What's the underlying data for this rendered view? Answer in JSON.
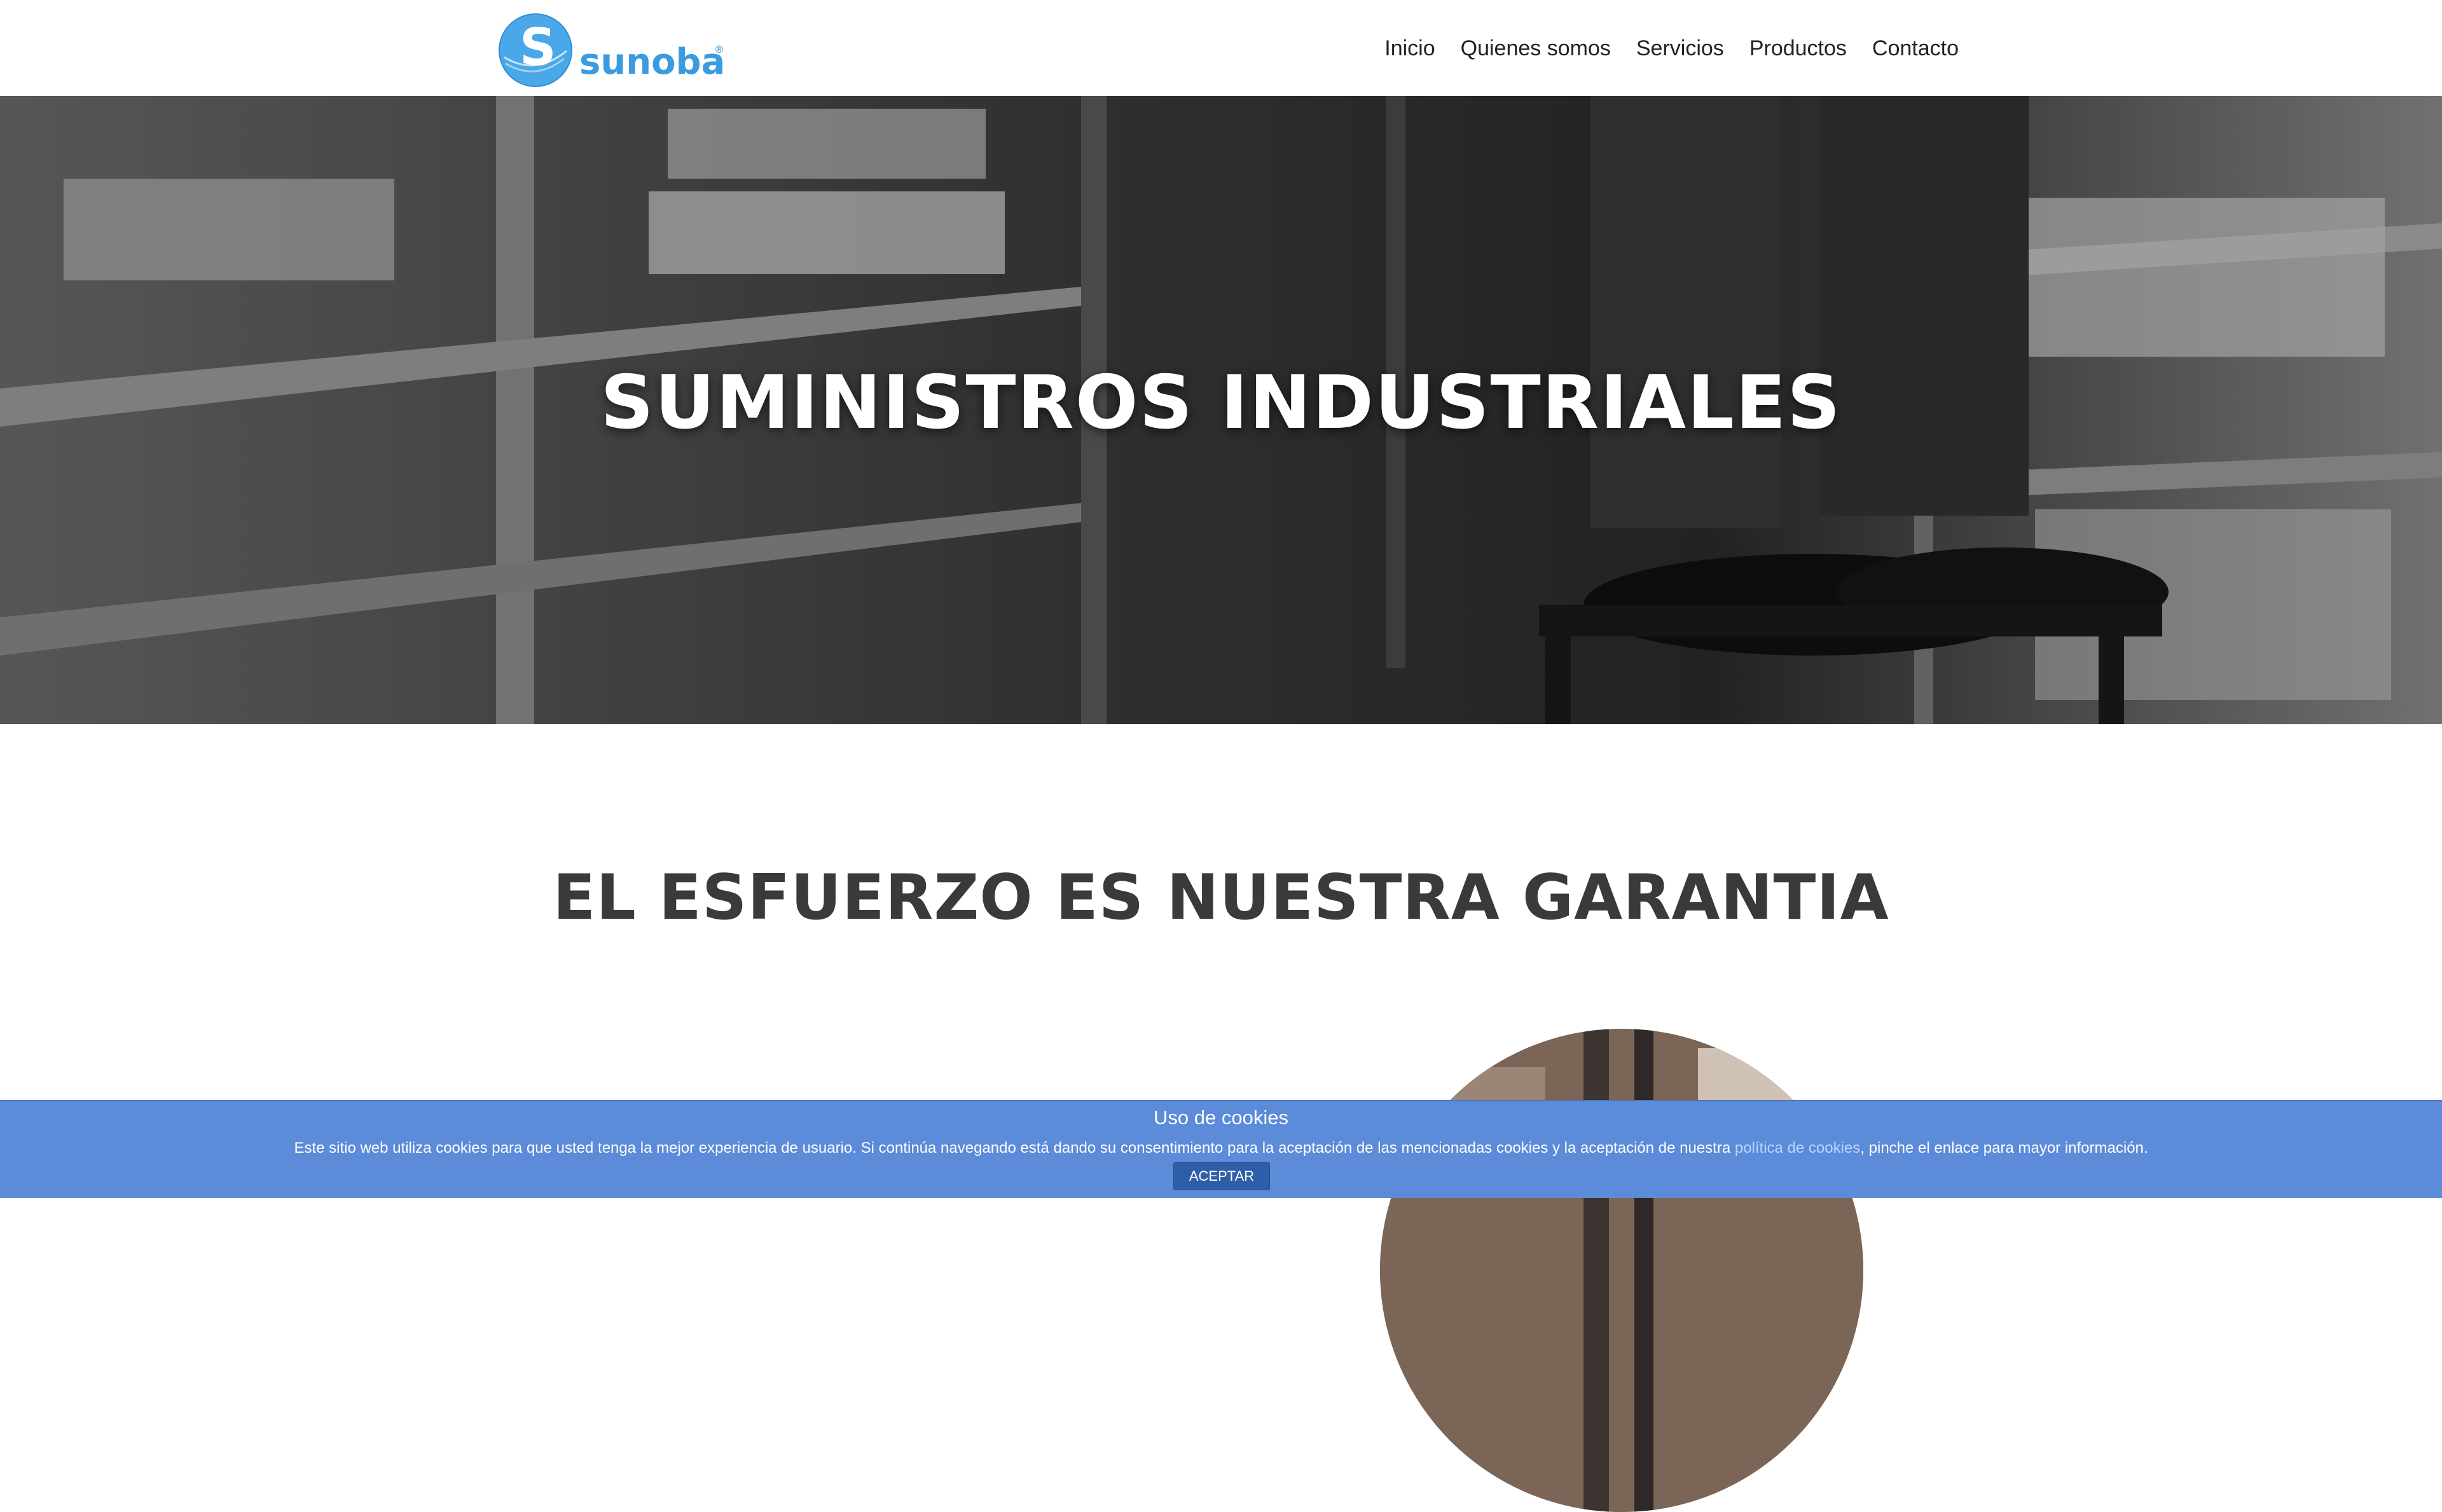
{
  "header": {
    "logo_text": "sunoba",
    "logo_mark": "®",
    "nav": [
      {
        "label": "Inicio"
      },
      {
        "label": "Quienes somos"
      },
      {
        "label": "Servicios"
      },
      {
        "label": "Productos"
      },
      {
        "label": "Contacto"
      }
    ]
  },
  "hero": {
    "title": "SUMINISTROS INDUSTRIALES"
  },
  "section": {
    "title": "EL ESFUERZO ES NUESTRA GARANTIA"
  },
  "cookie": {
    "title": "Uso de cookies",
    "text_before": "Este sitio web utiliza cookies para que usted tenga la mejor experiencia de usuario. Si continúa navegando está dando su consentimiento para la aceptación de las mencionadas cookies y la aceptación de nuestra ",
    "link_text": "política de cookies",
    "text_after": ", pinche el enlace para mayor información.",
    "accept_label": "ACEPTAR"
  },
  "colors": {
    "brand": "#3a9be0",
    "cookie_bar": "#5b8bd9",
    "cookie_button": "#2f5ea8",
    "heading": "#3a3a3a"
  }
}
